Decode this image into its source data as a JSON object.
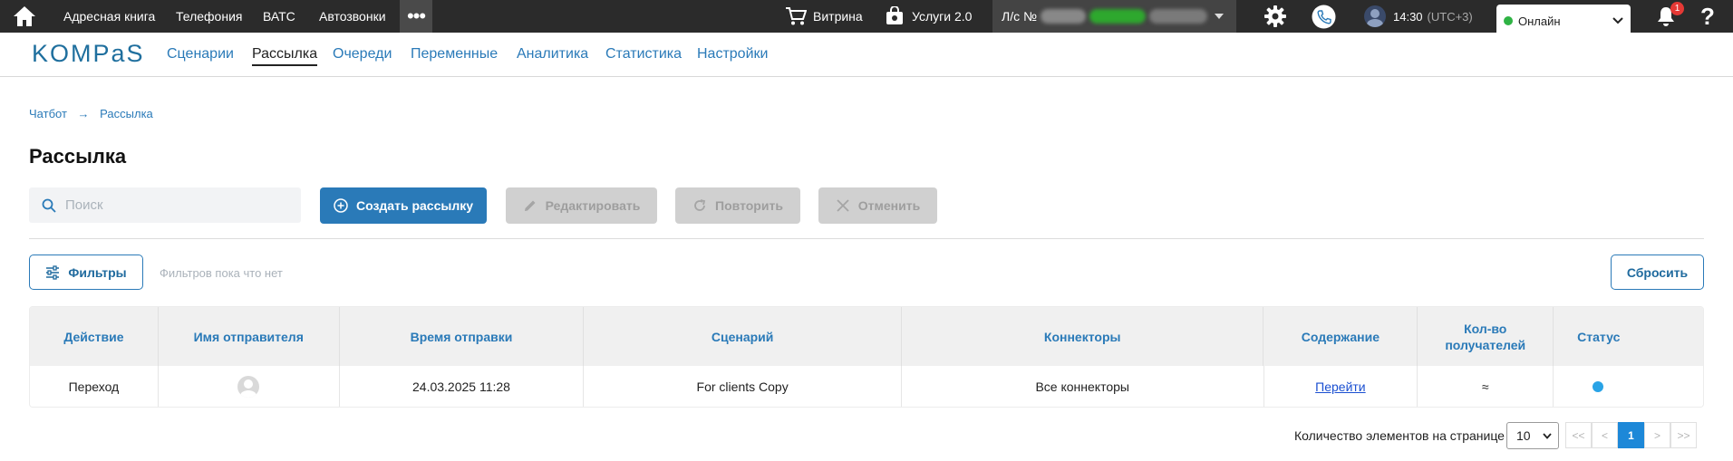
{
  "topbar": {
    "nav": [
      "Адресная книга",
      "Телефония",
      "ВАТС",
      "Автозвонки"
    ],
    "more_label": "•••",
    "showcase": "Витрина",
    "services": "Услуги 2.0",
    "account_prefix": "Л/с №",
    "time": "14:30",
    "timezone": "(UTC+3)",
    "status": "Онлайн",
    "notifications_count": "1",
    "help": "?"
  },
  "subnav": {
    "logo": "KOMPaS",
    "tabs": [
      "Сценарии",
      "Рассылка",
      "Очереди",
      "Переменные",
      "Аналитика",
      "Статистика",
      "Настройки"
    ],
    "active_tab": "Рассылка"
  },
  "breadcrumb": [
    "Чатбот",
    "Рассылка"
  ],
  "page_title": "Рассылка",
  "search": {
    "placeholder": "Поиск",
    "value": ""
  },
  "actions": {
    "create": "Создать рассылку",
    "edit": "Редактировать",
    "repeat": "Повторить",
    "cancel": "Отменить"
  },
  "filters": {
    "button": "Фильтры",
    "hint": "Фильтров пока что нет",
    "reset": "Сбросить"
  },
  "table": {
    "columns": [
      "Действие",
      "Имя отправителя",
      "Время отправки",
      "Сценарий",
      "Коннекторы",
      "Содержание",
      "Кол-во получателей",
      "Статус"
    ],
    "rows": [
      {
        "action": "Переход",
        "sender": "",
        "time": "24.03.2025 11:28",
        "scenario": "For clients Copy",
        "connectors": "Все коннекторы",
        "content": "Перейти",
        "recipients": "≈",
        "status_color": "#29a3e6"
      }
    ]
  },
  "pagination": {
    "per_page_label": "Количество элементов на странице",
    "per_page": "10",
    "first": "<<",
    "prev": "<",
    "current": "1",
    "next": ">",
    "last": ">>"
  },
  "colors": {
    "accent": "#2a7ab8",
    "topbar": "#2b2b2b",
    "online": "#2fb344",
    "badge": "#e53935",
    "page_active": "#1d88d8"
  }
}
